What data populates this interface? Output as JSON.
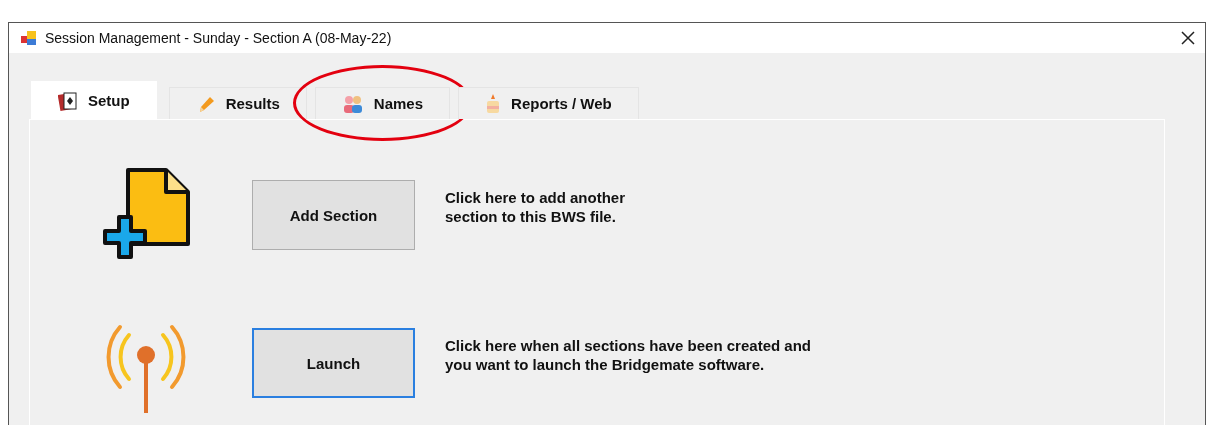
{
  "window": {
    "title": "Session Management - Sunday - Section A (08-May-22)"
  },
  "tabs": [
    {
      "label": "Setup",
      "selected": true,
      "circled": false,
      "kind": "cards"
    },
    {
      "label": "Results",
      "selected": false,
      "circled": false,
      "kind": "pencil"
    },
    {
      "label": "Names",
      "selected": false,
      "circled": true,
      "kind": "people"
    },
    {
      "label": "Reports / Web",
      "selected": false,
      "circled": false,
      "kind": "cake"
    }
  ],
  "actions": [
    {
      "kind": "add",
      "button": "Add Section",
      "focused": false,
      "description": "Click here to add another\nsection to this BWS file."
    },
    {
      "kind": "launch",
      "button": "Launch",
      "focused": true,
      "description": "Click here when all sections have been created and\nyou want to launch the Bridgemate software."
    }
  ]
}
